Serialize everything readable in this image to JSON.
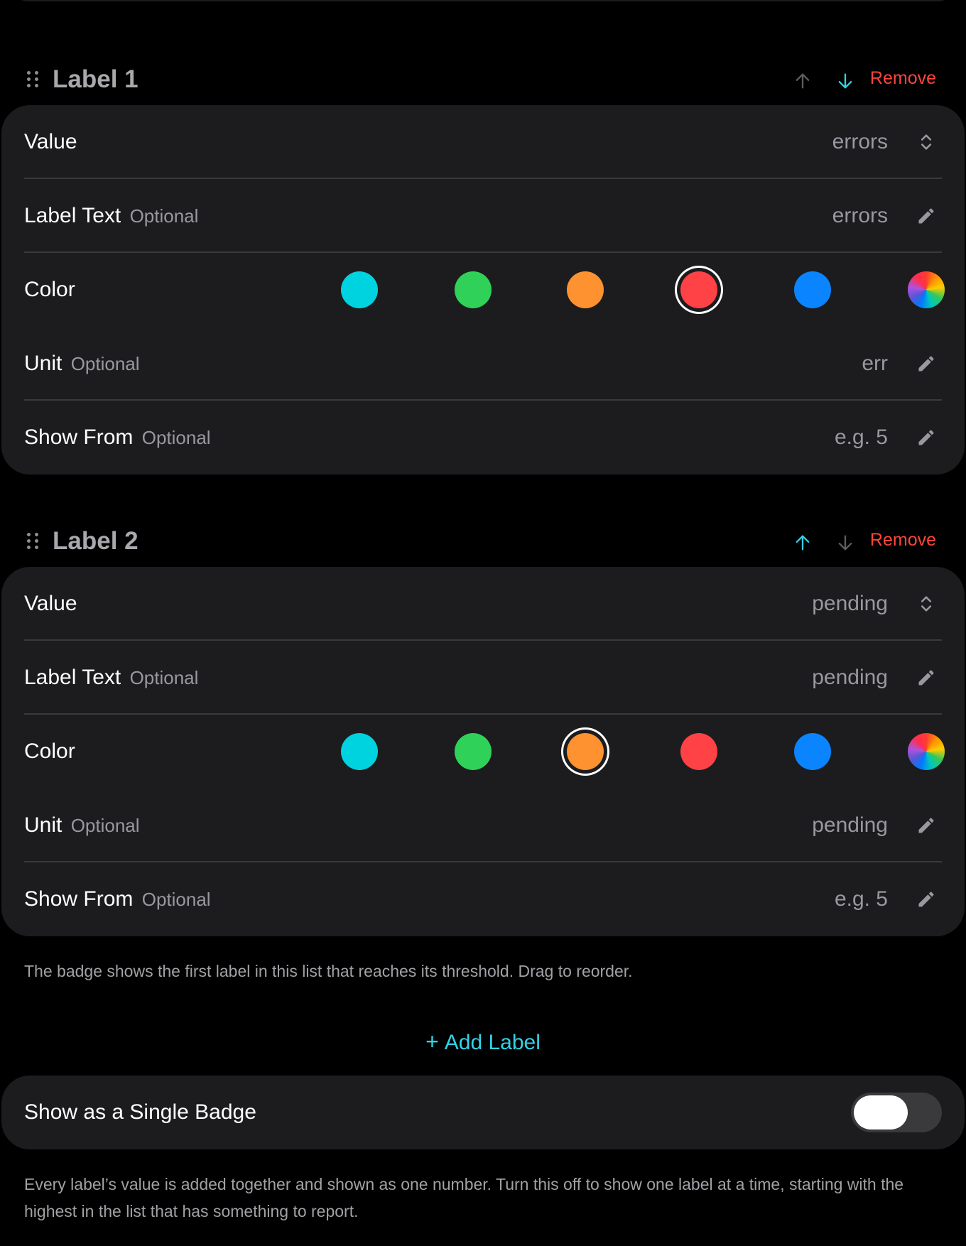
{
  "labels": [
    {
      "title": "Label 1",
      "move_up_enabled": false,
      "move_down_enabled": true,
      "remove_label": "Remove",
      "value_label": "Value",
      "value": "errors",
      "label_text_label": "Label Text",
      "label_text_value": "errors",
      "color_label": "Color",
      "selected_color": "red",
      "unit_label": "Unit",
      "unit_value": "err",
      "show_from_label": "Show From",
      "show_from_placeholder": "e.g. 5",
      "optional_text": "Optional"
    },
    {
      "title": "Label 2",
      "move_up_enabled": true,
      "move_down_enabled": false,
      "remove_label": "Remove",
      "value_label": "Value",
      "value": "pending",
      "label_text_label": "Label Text",
      "label_text_value": "pending",
      "color_label": "Color",
      "selected_color": "orange",
      "unit_label": "Unit",
      "unit_value": "pending",
      "show_from_label": "Show From",
      "show_from_placeholder": "e.g. 5",
      "optional_text": "Optional"
    }
  ],
  "colors": [
    {
      "name": "cyan",
      "hex": "#00d3e0"
    },
    {
      "name": "green",
      "hex": "#30d158"
    },
    {
      "name": "orange",
      "hex": "#ff9230"
    },
    {
      "name": "red",
      "hex": "#ff4245"
    },
    {
      "name": "blue",
      "hex": "#0a84ff"
    },
    {
      "name": "custom",
      "hex": "rainbow"
    }
  ],
  "accent_color": "#32d2e6",
  "destructive_color": "#ff453a",
  "order_footnote": "The badge shows the first label in this list that reaches its threshold. Drag to reorder.",
  "add_label_text": "Add Label",
  "single_badge": {
    "label": "Show as a Single Badge",
    "enabled": false
  },
  "single_badge_footnote": "Every label’s value is added together and shown as one number. Turn this off to show one label at a time, starting with the highest in the list that has something to report."
}
